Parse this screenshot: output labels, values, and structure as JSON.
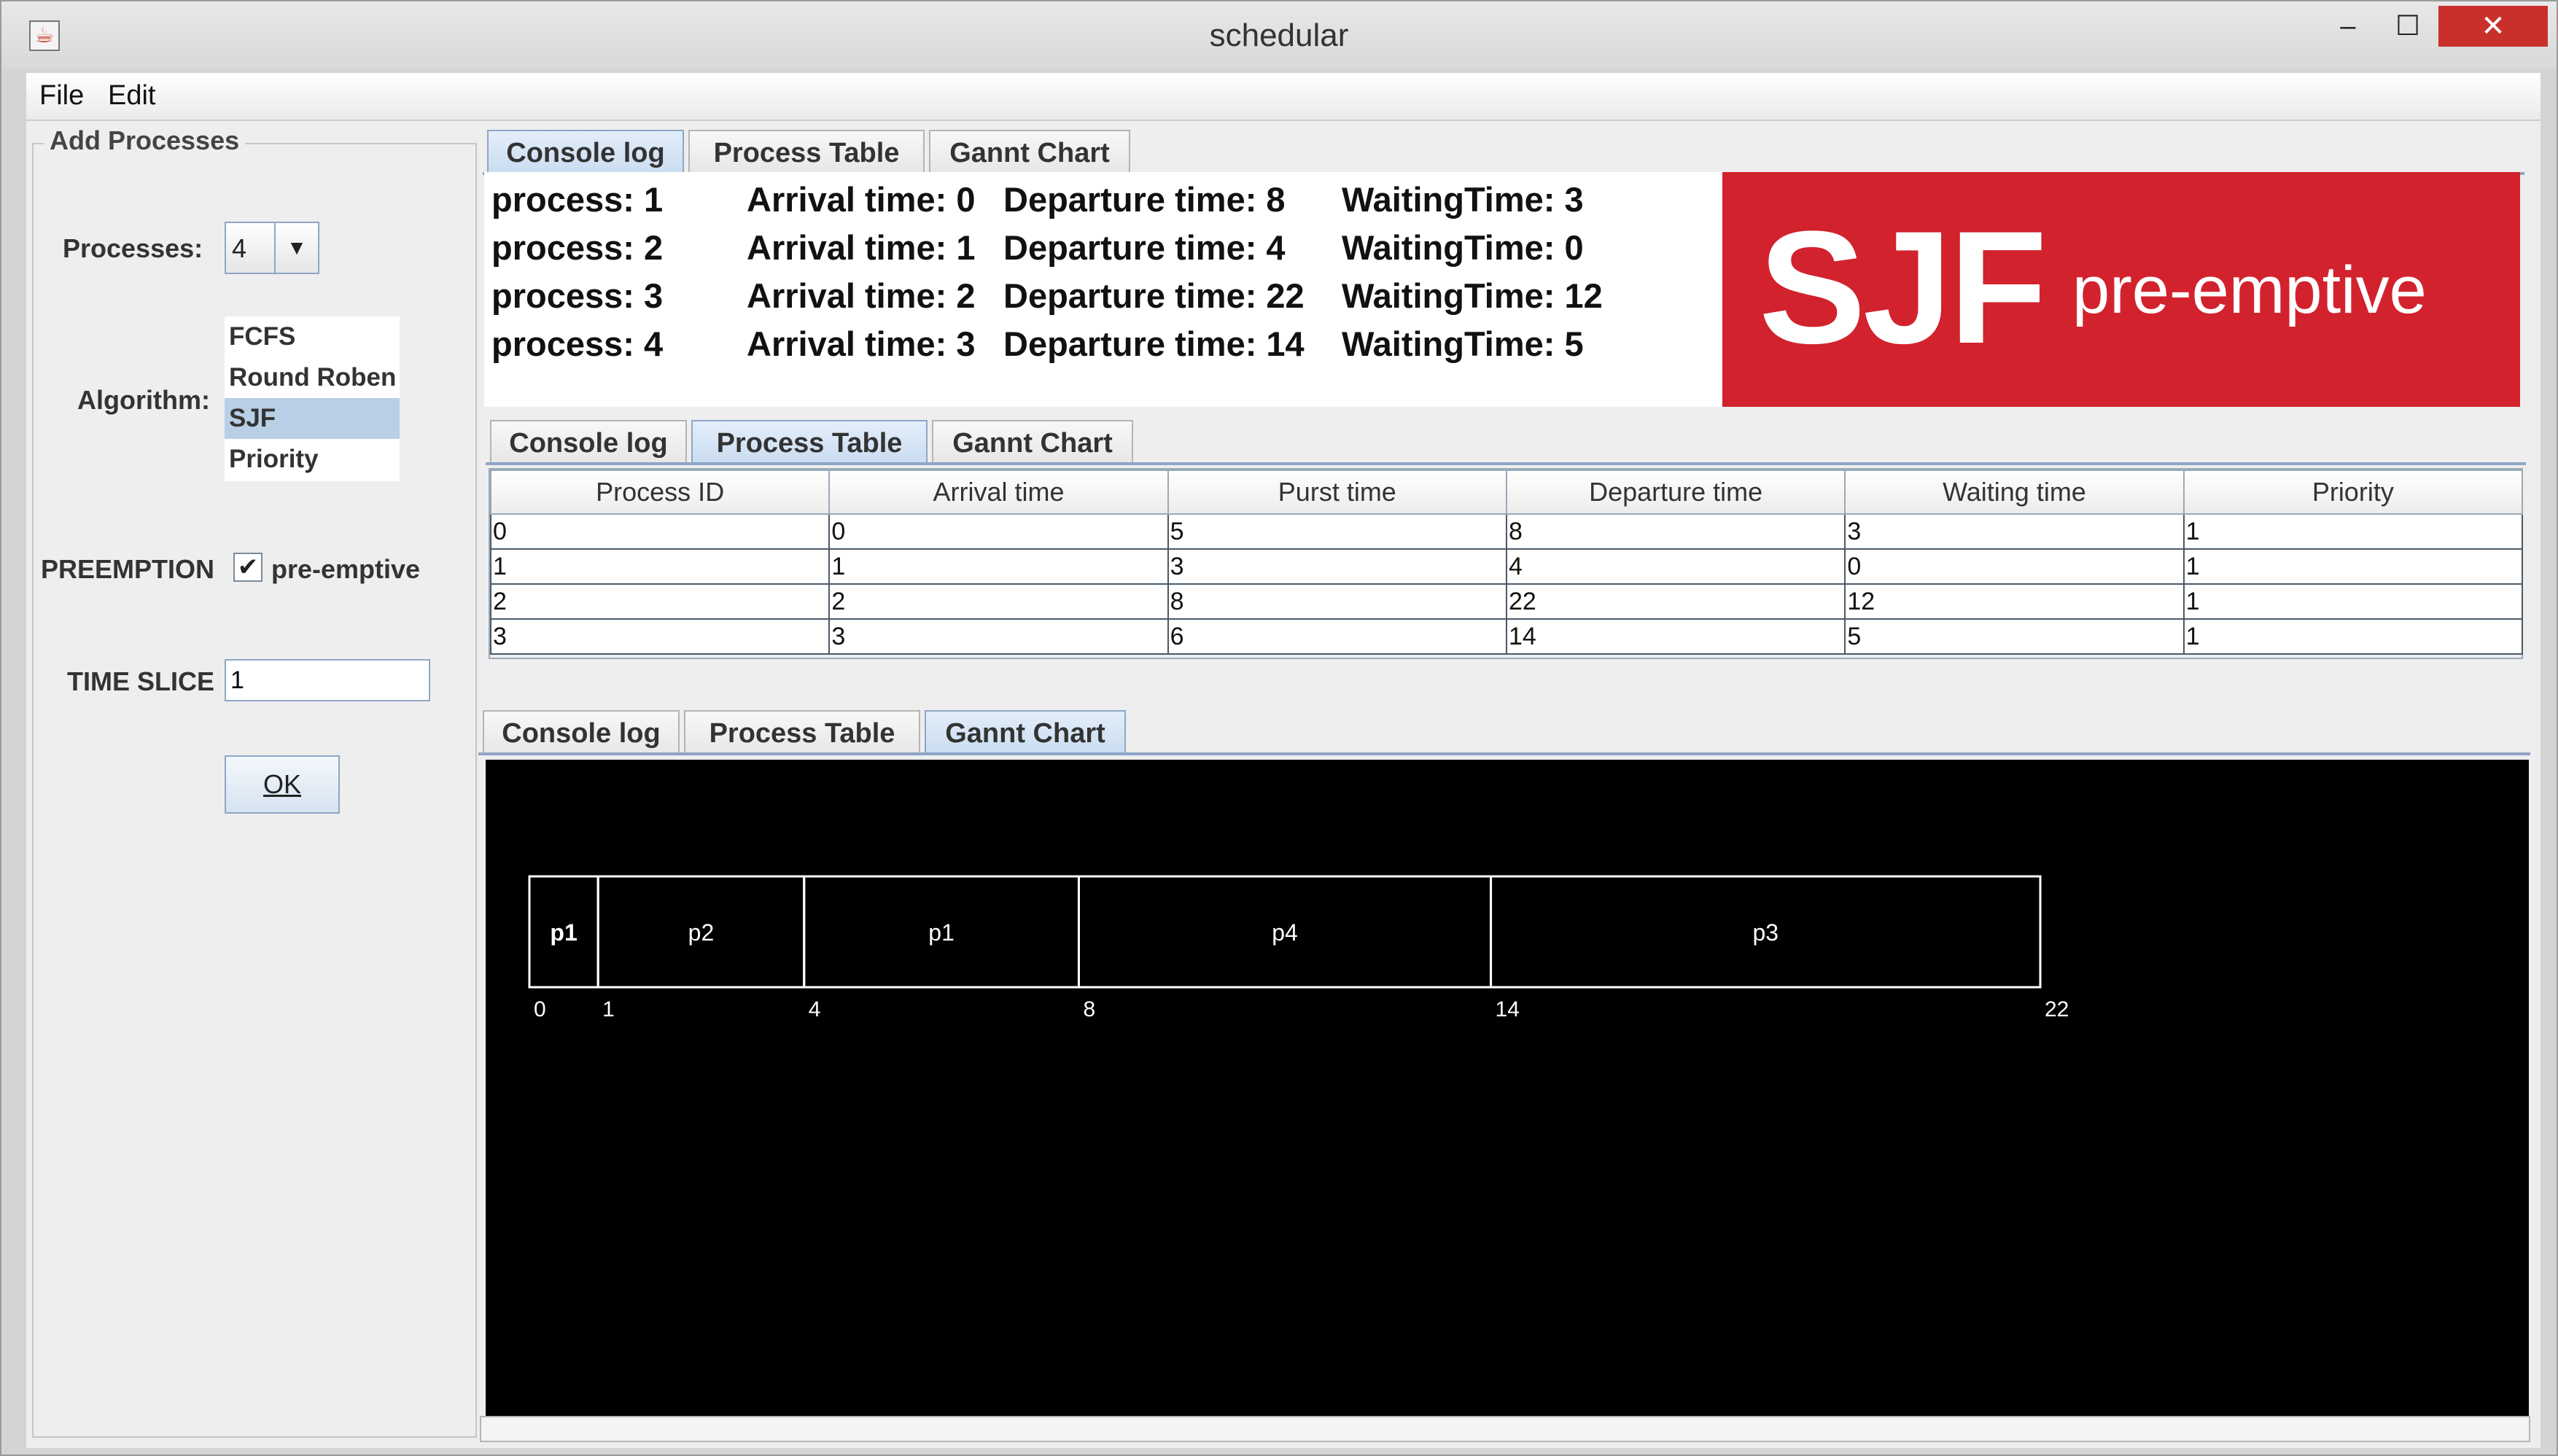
{
  "window": {
    "title": "schedular",
    "minimize_glyph": "–",
    "maximize_glyph": "☐",
    "close_glyph": "✕"
  },
  "menu": {
    "file": "File",
    "edit": "Edit"
  },
  "left_panel": {
    "group_title": "Add Processes",
    "processes_label": "Processes:",
    "processes_value": "4",
    "algorithm_label": "Algorithm:",
    "algorithms": [
      "FCFS",
      "Round Roben",
      "SJF",
      "Priority"
    ],
    "selected_algorithm": "SJF",
    "preemption_label": "PREEMPTION",
    "preemptive_checkbox_label": "pre-emptive",
    "preemptive_checked": true,
    "time_slice_label": "TIME SLICE",
    "time_slice_value": "1",
    "ok_label": "OK"
  },
  "tabs": [
    "Console log",
    "Process Table",
    "Gannt Chart"
  ],
  "console": {
    "lines": [
      {
        "process": "process: 1",
        "arrival": "Arrival time: 0",
        "departure": "Departure time: 8",
        "waiting": "WaitingTime: 3"
      },
      {
        "process": "process: 2",
        "arrival": "Arrival time: 1",
        "departure": "Departure time: 4",
        "waiting": "WaitingTime: 0"
      },
      {
        "process": "process: 3",
        "arrival": "Arrival time: 2",
        "departure": "Departure time: 22",
        "waiting": "WaitingTime: 12"
      },
      {
        "process": "process: 4",
        "arrival": "Arrival time: 3",
        "departure": "Departure time: 14",
        "waiting": "WaitingTime: 5"
      }
    ],
    "banner_big": "SJF",
    "banner_small": "pre-emptive",
    "banner_color": "#d2222d"
  },
  "process_table": {
    "headers": [
      "Process ID",
      "Arrival time",
      "Purst time",
      "Departure time",
      "Waiting time",
      "Priority"
    ],
    "rows": [
      [
        "0",
        "0",
        "5",
        "8",
        "3",
        "1"
      ],
      [
        "1",
        "1",
        "3",
        "4",
        "0",
        "1"
      ],
      [
        "2",
        "2",
        "8",
        "22",
        "12",
        "1"
      ],
      [
        "3",
        "3",
        "6",
        "14",
        "5",
        "1"
      ]
    ]
  },
  "gantt": {
    "segments": [
      {
        "label": "p1",
        "start": 0,
        "end": 1
      },
      {
        "label": "p2",
        "start": 1,
        "end": 4
      },
      {
        "label": "p1",
        "start": 4,
        "end": 8
      },
      {
        "label": "p4",
        "start": 8,
        "end": 14
      },
      {
        "label": "p3",
        "start": 14,
        "end": 22
      }
    ],
    "ticks": [
      "0",
      "1",
      "4",
      "8",
      "14",
      "22"
    ],
    "background": "#000000",
    "foreground": "#ffffff"
  }
}
